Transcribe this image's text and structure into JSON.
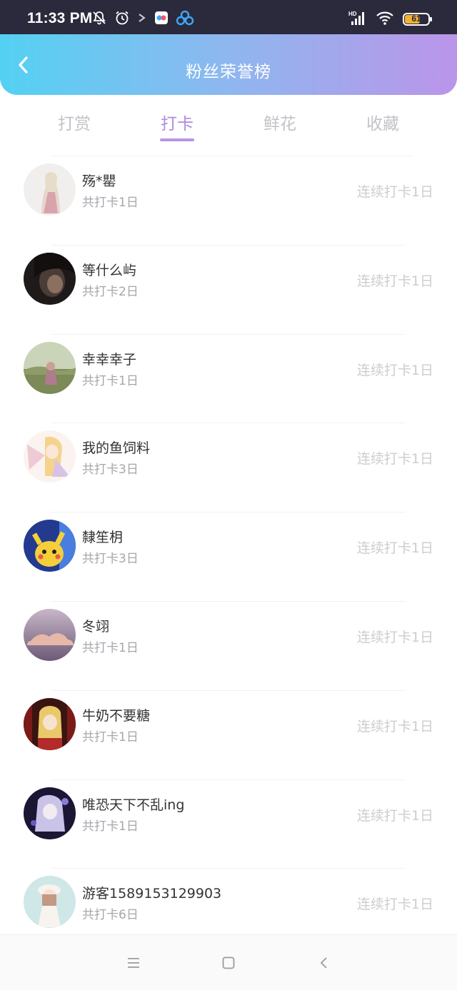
{
  "status_bar": {
    "time": "11:33 PM",
    "battery_level": "61",
    "battery_fraction": 0.61,
    "left_icons": [
      "bell-off-icon",
      "alarm-icon",
      "arrow-icon",
      "app-icon",
      "app-icon-2"
    ],
    "right_icons": [
      "signal-icon",
      "wifi-icon",
      "battery-icon"
    ]
  },
  "header": {
    "title": "粉丝荣誉榜",
    "back_icon": "chevron-left-icon"
  },
  "tabs": [
    {
      "label": "打赏",
      "active": false
    },
    {
      "label": "打卡",
      "active": true
    },
    {
      "label": "鲜花",
      "active": false
    },
    {
      "label": "收藏",
      "active": false
    }
  ],
  "fans": [
    {
      "name": "殇*罌",
      "total": "共打卡1日",
      "streak": "连续打卡1日"
    },
    {
      "name": "等什么屿",
      "total": "共打卡2日",
      "streak": "连续打卡1日"
    },
    {
      "name": "幸幸幸子",
      "total": "共打卡1日",
      "streak": "连续打卡1日"
    },
    {
      "name": "我的鱼饲料",
      "total": "共打卡3日",
      "streak": "连续打卡1日"
    },
    {
      "name": "隸笙枂",
      "total": "共打卡3日",
      "streak": "连续打卡1日"
    },
    {
      "name": "冬翊",
      "total": "共打卡1日",
      "streak": "连续打卡1日"
    },
    {
      "name": "牛奶不要糖",
      "total": "共打卡1日",
      "streak": "连续打卡1日"
    },
    {
      "name": "唯恐天下不乱ing",
      "total": "共打卡1日",
      "streak": "连续打卡1日"
    },
    {
      "name": "游客1589153129903",
      "total": "共打卡6日",
      "streak": "连续打卡1日"
    }
  ],
  "colors": {
    "header_gradient_start": "#54d1f2",
    "header_gradient_end": "#bb95e9",
    "tab_active": "#b08bde",
    "tab_inactive": "#c2c2c8",
    "streak_text": "#cdcdd2"
  },
  "bottom_nav": {
    "icons": [
      "menu-icon",
      "home-square-icon",
      "back-triangle-icon"
    ]
  }
}
